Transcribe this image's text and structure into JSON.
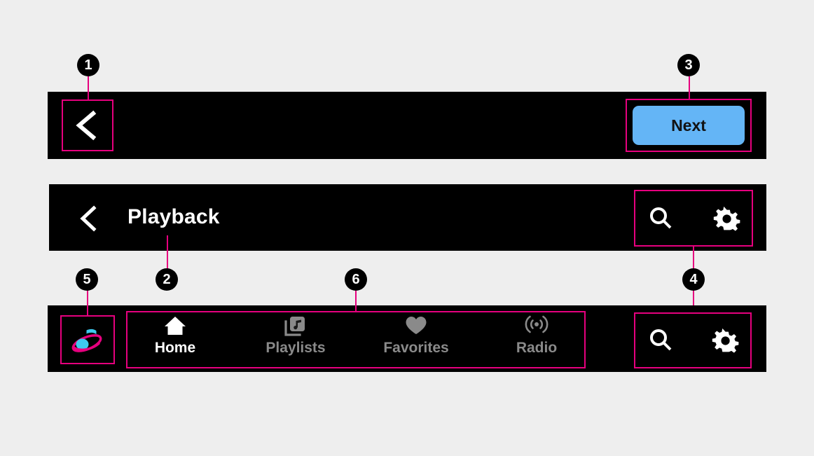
{
  "page": {
    "background_color": "#eeeeee",
    "bar_color": "#000000",
    "annotation_color": "#e6007e"
  },
  "top_bar": {
    "back_button": {
      "icon": "chevron-left-icon",
      "label": "Back"
    },
    "next_button": {
      "label": "Next",
      "background_color": "#64b5f6",
      "text_color": "#121212"
    }
  },
  "header_bar": {
    "back_button": {
      "icon": "chevron-left-icon",
      "label": "Back"
    },
    "title": "Playback",
    "actions": [
      {
        "name": "search",
        "icon": "search-icon"
      },
      {
        "name": "settings",
        "icon": "gear-icon"
      }
    ]
  },
  "tab_bar": {
    "brand": {
      "name": "app-logo",
      "icon": "music-note-orbit-logo",
      "note_color": "#3ec9ee",
      "ring_color": "#e6007e"
    },
    "tabs": [
      {
        "label": "Home",
        "icon": "home-icon",
        "active": true
      },
      {
        "label": "Playlists",
        "icon": "playlist-icon",
        "active": false
      },
      {
        "label": "Favorites",
        "icon": "heart-icon",
        "active": false
      },
      {
        "label": "Radio",
        "icon": "radio-broadcast-icon",
        "active": false
      }
    ],
    "actions": [
      {
        "name": "search",
        "icon": "search-icon"
      },
      {
        "name": "settings",
        "icon": "gear-icon"
      }
    ],
    "active_color": "#ffffff",
    "inactive_color": "#8a8a8a"
  },
  "callouts": [
    {
      "number": "1",
      "target": "top-bar-back-button"
    },
    {
      "number": "2",
      "target": "header-title"
    },
    {
      "number": "3",
      "target": "next-button"
    },
    {
      "number": "4",
      "target": "header-and-tab-actions"
    },
    {
      "number": "5",
      "target": "brand-logo"
    },
    {
      "number": "6",
      "target": "tab-group"
    }
  ]
}
